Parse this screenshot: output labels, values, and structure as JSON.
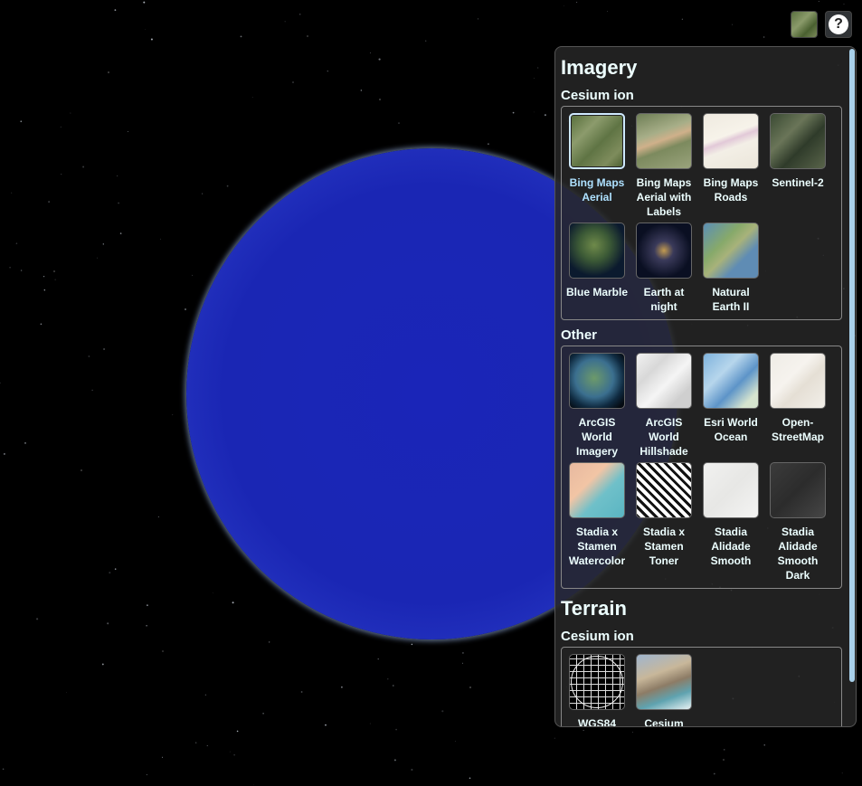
{
  "toolbar": {
    "base_layer_button_icon": "globe-thumbnail-icon",
    "help_button_glyph": "?",
    "help_icon": "question-mark-icon"
  },
  "picker": {
    "imagery_title": "Imagery",
    "terrain_title": "Terrain",
    "imagery_sections": [
      {
        "name": "Cesium ion",
        "items": [
          {
            "label": "Bing Maps Aerial",
            "selected": true,
            "icon": "bing-aerial-thumbnail"
          },
          {
            "label": "Bing Maps Aerial with Labels",
            "icon": "bing-labels-thumbnail"
          },
          {
            "label": "Bing Maps Roads",
            "icon": "bing-roads-thumbnail"
          },
          {
            "label": "Sentinel-2",
            "icon": "sentinel-thumbnail"
          },
          {
            "label": "Blue Marble",
            "icon": "blue-marble-thumbnail"
          },
          {
            "label": "Earth at night",
            "icon": "earth-night-thumbnail"
          },
          {
            "label": "Natural Earth II",
            "icon": "natural-earth-thumbnail"
          }
        ]
      },
      {
        "name": "Other",
        "items": [
          {
            "label": "ArcGIS World Imagery",
            "icon": "arcgis-imagery-thumbnail"
          },
          {
            "label": "ArcGIS World Hillshade",
            "icon": "arcgis-hillshade-thumbnail"
          },
          {
            "label": "Esri World Ocean",
            "icon": "esri-ocean-thumbnail"
          },
          {
            "label": "Open­StreetMap",
            "icon": "osm-thumbnail"
          },
          {
            "label": "Stadia x Stamen Watercolor",
            "icon": "watercolor-thumbnail"
          },
          {
            "label": "Stadia x Stamen Toner",
            "icon": "toner-thumbnail"
          },
          {
            "label": "Stadia Alidade Smooth",
            "icon": "alidade-thumbnail"
          },
          {
            "label": "Stadia Alidade Smooth Dark",
            "icon": "alidade-dark-thumbnail"
          }
        ]
      }
    ],
    "terrain_sections": [
      {
        "name": "Cesium ion",
        "items": [
          {
            "label": "WGS84",
            "icon": "wgs84-ellipsoid-thumbnail"
          },
          {
            "label": "Cesium",
            "icon": "cesium-terrain-thumbnail"
          }
        ]
      }
    ]
  },
  "colors": {
    "globe": "#1a26b4",
    "panel_bg": "#262626",
    "selected_label": "#aee1ff",
    "scrollbar": "#a8d0ea"
  }
}
